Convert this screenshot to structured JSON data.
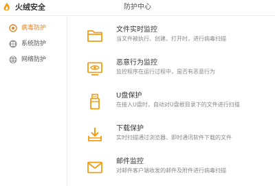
{
  "app": {
    "name": "火绒安全",
    "page_title": "防护中心",
    "accent_color": "#f39c12"
  },
  "sidebar": {
    "items": [
      {
        "label": "病毒防护",
        "icon": "shield-target-icon",
        "active": true
      },
      {
        "label": "系统防护",
        "icon": "windows-icon",
        "active": false
      },
      {
        "label": "网络防护",
        "icon": "globe-icon",
        "active": false
      }
    ]
  },
  "items": [
    {
      "title": "文件实时监控",
      "desc": "当文件被执行、创建、打开时，进行病毒扫描",
      "icon": "folder-icon"
    },
    {
      "title": "恶意行为监控",
      "desc": "监控程序在运行过程中，是否有恶意行为",
      "icon": "monitor-eye-icon"
    },
    {
      "title": "U盘保护",
      "desc": "在接入U盘时，自动对U盘根目录下的文件进行扫描",
      "icon": "usb-drive-icon"
    },
    {
      "title": "下载保护",
      "desc": "实时扫描通过浏览器、即时通讯软件下载的文件",
      "icon": "download-icon"
    },
    {
      "title": "邮件监控",
      "desc": "对邮件客户端收发的邮件及附件进行病毒扫描",
      "icon": "mail-icon"
    }
  ]
}
